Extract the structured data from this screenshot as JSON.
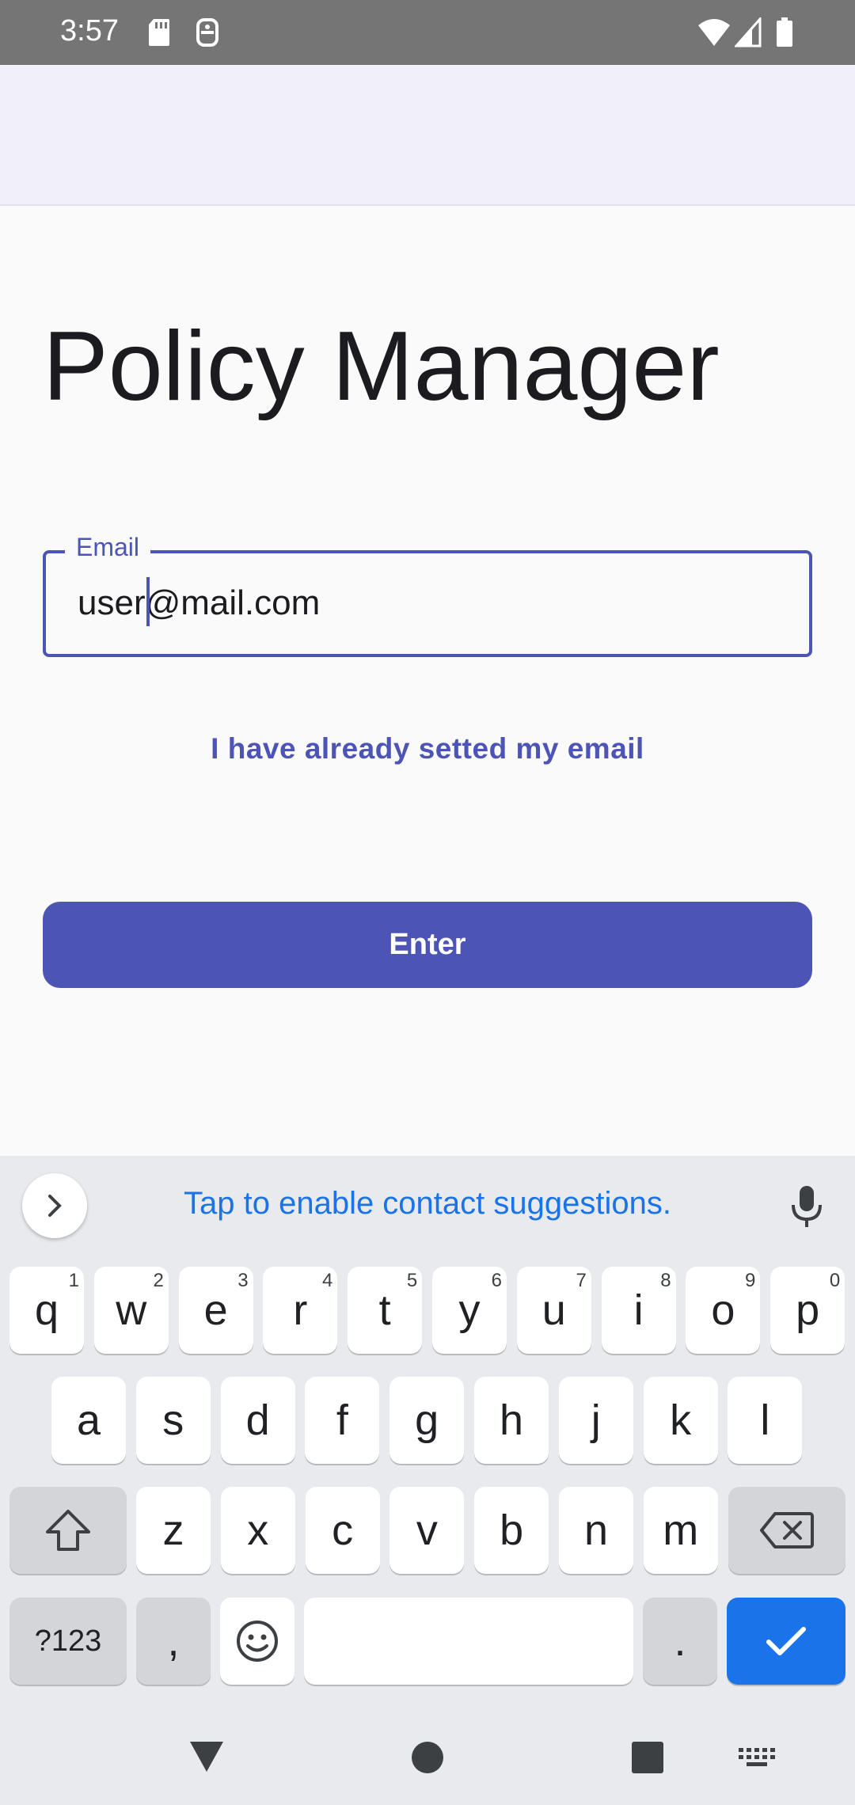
{
  "status_bar": {
    "time": "3:57"
  },
  "app": {
    "title": "Policy Manager",
    "email_field": {
      "label": "Email",
      "value": "user@mail.com"
    },
    "already_set_link": "I have already setted my email",
    "enter_button": "Enter"
  },
  "keyboard": {
    "suggestion_text": "Tap to enable contact suggestions.",
    "row1": [
      {
        "key": "q",
        "hint": "1"
      },
      {
        "key": "w",
        "hint": "2"
      },
      {
        "key": "e",
        "hint": "3"
      },
      {
        "key": "r",
        "hint": "4"
      },
      {
        "key": "t",
        "hint": "5"
      },
      {
        "key": "y",
        "hint": "6"
      },
      {
        "key": "u",
        "hint": "7"
      },
      {
        "key": "i",
        "hint": "8"
      },
      {
        "key": "o",
        "hint": "9"
      },
      {
        "key": "p",
        "hint": "0"
      }
    ],
    "row2": [
      "a",
      "s",
      "d",
      "f",
      "g",
      "h",
      "j",
      "k",
      "l"
    ],
    "row3": [
      "z",
      "x",
      "c",
      "v",
      "b",
      "n",
      "m"
    ],
    "symbols_key": "?123",
    "comma_key": ",",
    "period_key": "."
  },
  "colors": {
    "accent": "#4c55b5",
    "keyboard_accent": "#1a73e8"
  }
}
